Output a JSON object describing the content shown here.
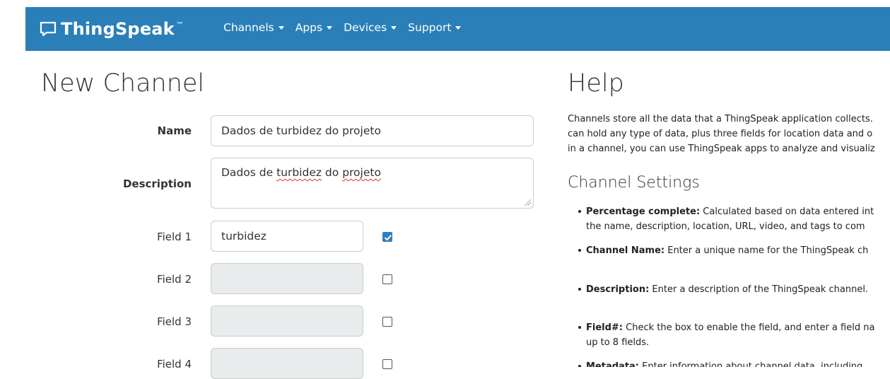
{
  "header": {
    "brand": "ThingSpeak",
    "trademark": "™",
    "nav": [
      {
        "label": "Channels",
        "icon": "caret-down-icon"
      },
      {
        "label": "Apps",
        "icon": "caret-down-icon"
      },
      {
        "label": "Devices",
        "icon": "caret-down-icon"
      },
      {
        "label": "Support",
        "icon": "caret-down-icon"
      }
    ]
  },
  "form": {
    "title": "New Channel",
    "name": {
      "label": "Name",
      "value": "Dados de turbidez do projeto"
    },
    "description": {
      "label": "Description",
      "value_part1": "Dados de ",
      "value_word1": "turbidez",
      "value_part2": " do ",
      "value_word2": "projeto"
    },
    "fields": [
      {
        "label": "Field 1",
        "value": "turbidez",
        "checked": true
      },
      {
        "label": "Field 2",
        "value": "",
        "checked": false
      },
      {
        "label": "Field 3",
        "value": "",
        "checked": false
      },
      {
        "label": "Field 4",
        "value": "",
        "checked": false
      }
    ]
  },
  "help": {
    "title": "Help",
    "paragraph": [
      "Channels store all the data that a ThingSpeak application collects.",
      "can hold any type of data, plus three fields for location data and o",
      "in a channel, you can use ThingSpeak apps to analyze and visualiz"
    ],
    "settings_title": "Channel Settings",
    "bullets": [
      {
        "term": "Percentage complete:",
        "text": " Calculated based on data entered int",
        "line2": "the name, description, location, URL, video, and tags to com"
      },
      {
        "term": "Channel Name:",
        "text": " Enter a unique name for the ThingSpeak ch"
      },
      {
        "term": "Description:",
        "text": " Enter a description of the ThingSpeak channel."
      },
      {
        "term": "Field#:",
        "text": " Check the box to enable the field, and enter a field na",
        "line2": "up to 8 fields."
      },
      {
        "term": "Metadata:",
        "text": " Enter information about channel data, including"
      }
    ]
  },
  "colors": {
    "navbar": "#2a7fb8",
    "checkbox_checked": "#2f80c2",
    "disabled_input": "#e9ecec"
  }
}
